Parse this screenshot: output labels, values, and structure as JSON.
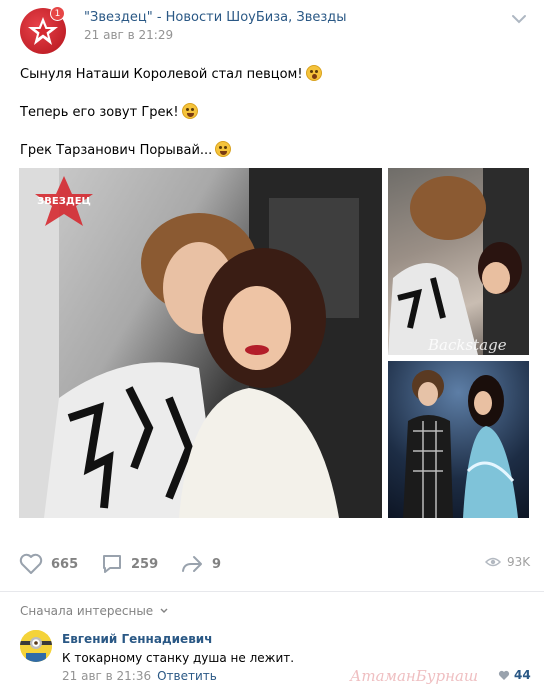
{
  "post": {
    "group_name": "\"Звездец\" - Новости ШоуБиза, Звезды",
    "date": "21 авг в 21:29",
    "avatar_badge": "1",
    "lines": [
      "Сынуля Наташи Королевой стал певцом!",
      "Теперь его зовут Грек!",
      "Грек Тарзанович Порывай..."
    ],
    "photo_watermark": "ЗВЕЗДЕЦ",
    "photo_side_watermark": "Backstage"
  },
  "actions": {
    "likes": "665",
    "comments": "259",
    "shares": "9",
    "views": "93K"
  },
  "comments_section": {
    "sort_label": "Сначала интересные",
    "comment": {
      "author": "Евгений Геннадиевич",
      "text": "К токарному станку душа не лежит.",
      "date": "21 авг в 21:36",
      "reply_label": "Ответить",
      "likes": "44",
      "watermark": "АтаманБурнаш"
    }
  },
  "colors": {
    "link": "#2a5885",
    "muted": "#939393",
    "accent_red": "#c81d25"
  }
}
